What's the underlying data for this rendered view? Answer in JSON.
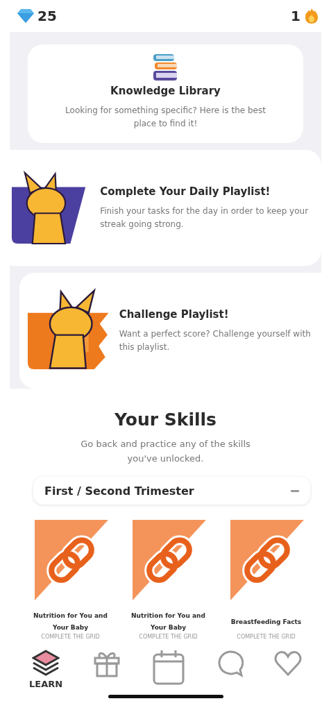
{
  "top_bar": {
    "gems": "25",
    "streak": "1"
  },
  "promos": [
    {
      "kind": "library",
      "title": "Knowledge Library",
      "text": "Looking for something specific? Here is the best place to find it!"
    },
    {
      "kind": "left-art",
      "title": "Complete Your Daily Playlist!",
      "text": "Finish your tasks for the day in order to keep your streak going strong."
    },
    {
      "kind": "right-art",
      "title": "Challenge Playlist!",
      "text": "Want a perfect score? Challenge yourself with this playlist."
    }
  ],
  "skills": {
    "title": "Your Skills",
    "subtitle": "Go back and practice any of the skills you've unlocked.",
    "group": {
      "label": "First / Second Trimester",
      "expanded": true
    },
    "items": [
      {
        "title": "Nutrition for You and Your Baby",
        "status": "COMPLETE THE GRID"
      },
      {
        "title": "Nutrition for You and Your Baby",
        "status": "COMPLETE THE GRID"
      },
      {
        "title": "Breastfeeding Facts",
        "status": "COMPLETE THE GRID"
      }
    ]
  },
  "nav_tabs": [
    {
      "label": "LEARN",
      "selected": true
    },
    {
      "selected": false
    },
    {
      "selected": false
    },
    {
      "selected": false
    },
    {
      "selected": false
    }
  ]
}
